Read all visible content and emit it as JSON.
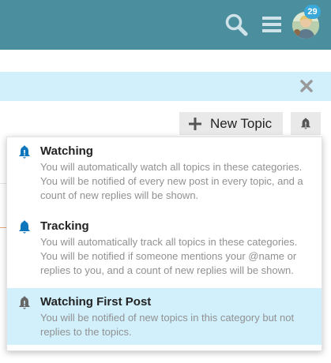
{
  "header": {
    "notification_count": "29",
    "icons": [
      "search-icon",
      "hamburger-menu-icon",
      "user-avatar"
    ]
  },
  "banner": {
    "close_icon": "close-icon"
  },
  "toolbar": {
    "new_topic_label": "New Topic",
    "new_topic_icon": "plus-icon",
    "notifications_icon": "bell-icon"
  },
  "notification_menu": {
    "options": [
      {
        "title": "Watching",
        "description": "You will automatically watch all topics in these categories. You will be notified of every new post in every topic, and a count of new replies will be shown.",
        "icon": "bell-icon",
        "icon_color": "#0e76bd",
        "selected": false
      },
      {
        "title": "Tracking",
        "description": "You will automatically track all topics in these categories. You will be notified if someone mentions your @name or replies to you, and a count of new replies will be shown.",
        "icon": "bell-icon",
        "icon_color": "#0e76bd",
        "selected": false
      },
      {
        "title": "Watching First Post",
        "description": "You will be notified of new topics in this category but not replies to the topics.",
        "icon": "bell-icon",
        "icon_color": "#666666",
        "selected": true
      }
    ]
  },
  "colors": {
    "header_bg": "#4b8f9f",
    "banner_bg": "#d1f0fc",
    "selected_bg": "#d1f0fc",
    "badge_bg": "#3aa8d8",
    "accent_blue": "#0e76bd"
  }
}
